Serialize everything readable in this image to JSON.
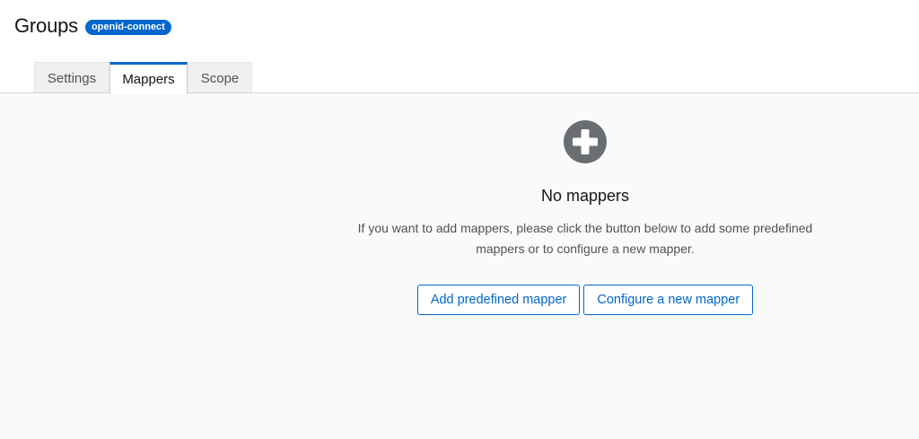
{
  "header": {
    "title": "Groups",
    "badge": "openid-connect"
  },
  "tabs": [
    {
      "label": "Settings",
      "active": false
    },
    {
      "label": "Mappers",
      "active": true
    },
    {
      "label": "Scope",
      "active": false
    }
  ],
  "empty_state": {
    "icon": "plus-circle-icon",
    "title": "No mappers",
    "body": "If you want to add mappers, please click the button below to add some predefined mappers or to configure a new mapper.",
    "primary_button": "Add predefined mapper",
    "secondary_button": "Configure a new mapper"
  },
  "colors": {
    "accent": "#0066cc",
    "icon": "#6a6e73",
    "content_bg": "#fafafa"
  }
}
